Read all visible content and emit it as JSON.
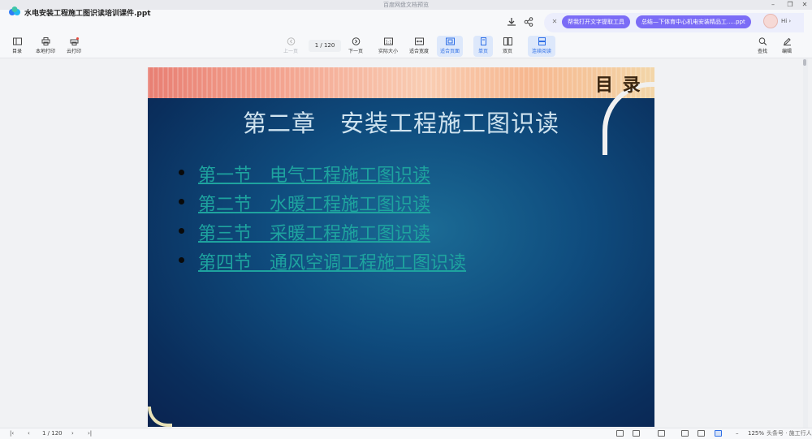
{
  "window": {
    "title": "百度网盘文档预览"
  },
  "header": {
    "doc_title": "水电安装工程施工图识读培训课件.ppt",
    "ai_chips": [
      "帮我打开文字提取工具",
      "总结—下体育中心机电安装精品工.....ppt"
    ],
    "ai_greeting": "Hi ›"
  },
  "toolbar": {
    "left": [
      {
        "label": "目录",
        "icon": "sidebar-icon"
      },
      {
        "label": "本地打印",
        "icon": "printer-icon"
      },
      {
        "label": "云打印",
        "icon": "cloud-printer-icon"
      }
    ],
    "prev_label": "上一页",
    "page_display": "1 / 120",
    "next_label": "下一页",
    "views": [
      {
        "label": "实际大小",
        "active": false
      },
      {
        "label": "适合宽度",
        "active": false
      },
      {
        "label": "适合页面",
        "active": true
      },
      {
        "label": "单页",
        "active": true
      },
      {
        "label": "双页",
        "active": false
      },
      {
        "label": "连续阅读",
        "active": true
      }
    ],
    "right": [
      {
        "label": "查找",
        "icon": "search-icon"
      },
      {
        "label": "编辑",
        "icon": "pen-icon"
      }
    ]
  },
  "slide": {
    "corner_title": "目 录",
    "title": "第二章　安装工程施工图识读",
    "toc": [
      "第一节　电气工程施工图识读",
      "第二节　水暖工程施工图识读",
      "第三节　采暖工程施工图识读",
      "第四节　通风空调工程施工图识读"
    ]
  },
  "status": {
    "page_display": "1 / 120",
    "zoom": "125%",
    "watermark": "头条号 · 施工行人"
  }
}
